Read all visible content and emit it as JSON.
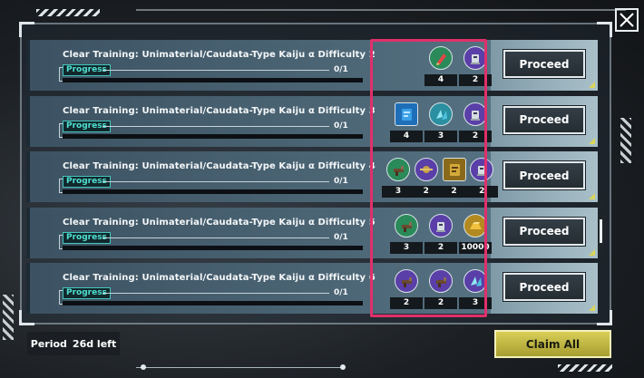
{
  "missions": [
    {
      "title": "Clear Training: Unimaterial/Caudata-Type Kaiju α Difficulty 2",
      "progress_label": "Progress",
      "progress": "0/1",
      "rewards": [
        {
          "icon": "red-crystal-icon",
          "qty": "4",
          "color": "#2a8a5a"
        },
        {
          "icon": "robot-icon",
          "qty": "2",
          "color": "#5a3fa8"
        }
      ],
      "button": "Proceed"
    },
    {
      "title": "Clear Training: Unimaterial/Caudata-Type Kaiju α Difficulty 3",
      "progress_label": "Progress",
      "progress": "0/1",
      "rewards": [
        {
          "icon": "blue-book-icon",
          "qty": "4",
          "color": "#1e6fb8"
        },
        {
          "icon": "blue-crystal-icon",
          "qty": "3",
          "color": "#2a8fa0"
        },
        {
          "icon": "robot-icon",
          "qty": "2",
          "color": "#5a3fa8"
        }
      ],
      "button": "Proceed"
    },
    {
      "title": "Clear Training: Unimaterial/Caudata-Type Kaiju α Difficulty 4",
      "progress_label": "Progress",
      "progress": "0/1",
      "rewards": [
        {
          "icon": "gun-part-icon",
          "qty": "3",
          "color": "#2a8a5a"
        },
        {
          "icon": "drone-icon",
          "qty": "2",
          "color": "#5a3fa8"
        },
        {
          "icon": "gold-book-icon",
          "qty": "2",
          "color": "#8a6a1a"
        },
        {
          "icon": "robot-icon",
          "qty": "2",
          "color": "#5a3fa8"
        }
      ],
      "button": "Proceed"
    },
    {
      "title": "Clear Training: Unimaterial/Caudata-Type Kaiju α Difficulty 5",
      "progress_label": "Progress",
      "progress": "0/1",
      "rewards": [
        {
          "icon": "gun-part-icon",
          "qty": "3",
          "color": "#2a8a5a"
        },
        {
          "icon": "robot-icon",
          "qty": "2",
          "color": "#5a3fa8"
        },
        {
          "icon": "gold-ingot-icon",
          "qty": "10000",
          "color": "#b38a20"
        }
      ],
      "button": "Proceed"
    },
    {
      "title": "Clear Training: Unimaterial/Caudata-Type Kaiju α Difficulty 6",
      "progress_label": "Progress",
      "progress": "0/1",
      "rewards": [
        {
          "icon": "gun-part-icon",
          "qty": "2",
          "color": "#5a3fa8"
        },
        {
          "icon": "gun-part-icon",
          "qty": "2",
          "color": "#5a3fa8"
        },
        {
          "icon": "blue-crystal-icon",
          "qty": "3",
          "color": "#5a3fa8"
        }
      ],
      "button": "Proceed"
    }
  ],
  "footer": {
    "period_label": "Period",
    "period_value": "26d left",
    "claim_all": "Claim All"
  },
  "colors": {
    "highlight": "#e0306b",
    "claim_button": "#d8cf58",
    "progress_accent": "#4fe0d2"
  }
}
